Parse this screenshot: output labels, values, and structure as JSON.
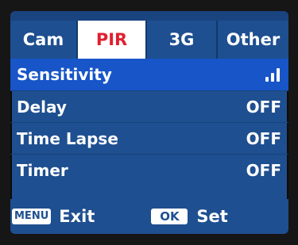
{
  "tabs": [
    {
      "label": "Cam",
      "active": false
    },
    {
      "label": "PIR",
      "active": true
    },
    {
      "label": "3G",
      "active": false
    },
    {
      "label": "Other",
      "active": false
    }
  ],
  "menu": [
    {
      "label": "Sensitivity",
      "value_icon": "signal-strength-icon",
      "signal_level": 3,
      "signal_max": 3
    },
    {
      "label": "Delay",
      "value": "OFF"
    },
    {
      "label": "Time Lapse",
      "value": "OFF"
    },
    {
      "label": "Timer",
      "value": "OFF"
    }
  ],
  "footer": {
    "menu_key": "MENU",
    "menu_action": "Exit",
    "ok_key": "OK",
    "ok_action": "Set"
  },
  "colors": {
    "background": "#1e4f90",
    "selected_row": "#1755c8",
    "active_tab_text": "#e02030",
    "active_tab_bg": "#ffffff"
  }
}
